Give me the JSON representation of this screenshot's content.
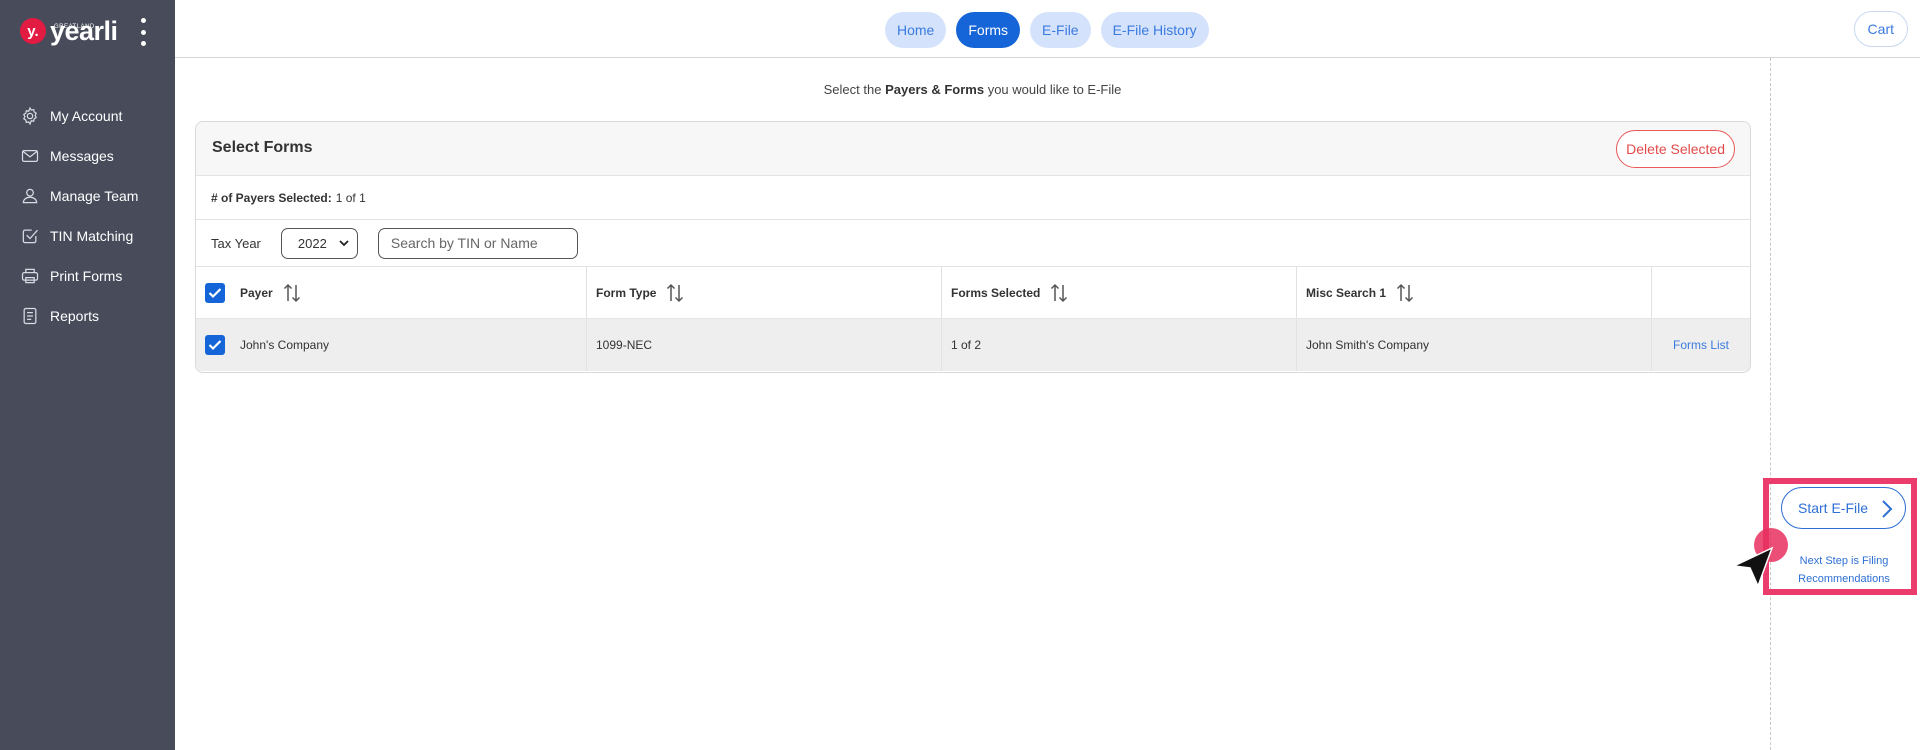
{
  "brand": {
    "badge": "y.",
    "small_text": "GREATLAND",
    "name": "yearli"
  },
  "sidebar": {
    "items": [
      {
        "label": "My Account",
        "icon": "gear-icon"
      },
      {
        "label": "Messages",
        "icon": "envelope-icon"
      },
      {
        "label": "Manage Team",
        "icon": "user-icon"
      },
      {
        "label": "TIN Matching",
        "icon": "check-square-icon"
      },
      {
        "label": "Print Forms",
        "icon": "printer-icon"
      },
      {
        "label": "Reports",
        "icon": "document-icon"
      }
    ]
  },
  "header": {
    "tabs": [
      {
        "label": "Home",
        "active": false
      },
      {
        "label": "Forms",
        "active": true
      },
      {
        "label": "E-File",
        "active": false
      },
      {
        "label": "E-File History",
        "active": false
      }
    ],
    "cart_label": "Cart"
  },
  "subtitle": {
    "pre": "Select the",
    "bold": "Payers & Forms",
    "post": "you would like to E-File"
  },
  "panel": {
    "title": "Select Forms",
    "delete_label": "Delete Selected",
    "payers_selected_label": "# of Payers Selected:",
    "payers_selected_value": "1 of 1",
    "tax_year_label": "Tax Year",
    "tax_year_value": "2022",
    "search_placeholder": "Search by TIN or Name"
  },
  "table": {
    "columns": [
      "Payer",
      "Form Type",
      "Forms Selected",
      "Misc Search 1"
    ],
    "rows": [
      {
        "payer": "John's Company",
        "form_type": "1099-NEC",
        "forms_selected": "1 of 2",
        "misc_search_1": "John Smith's Company",
        "action": "Forms List",
        "checked": true
      }
    ]
  },
  "action": {
    "start_label": "Start E-File",
    "next_step_line1": "Next Step is Filing",
    "next_step_line2": "Recommendations"
  },
  "colors": {
    "sidebar_bg": "#474b5a",
    "accent": "#1565d8",
    "brand_red": "#e21b43",
    "highlight": "#ea3d6d",
    "delete": "#e34b4b"
  }
}
